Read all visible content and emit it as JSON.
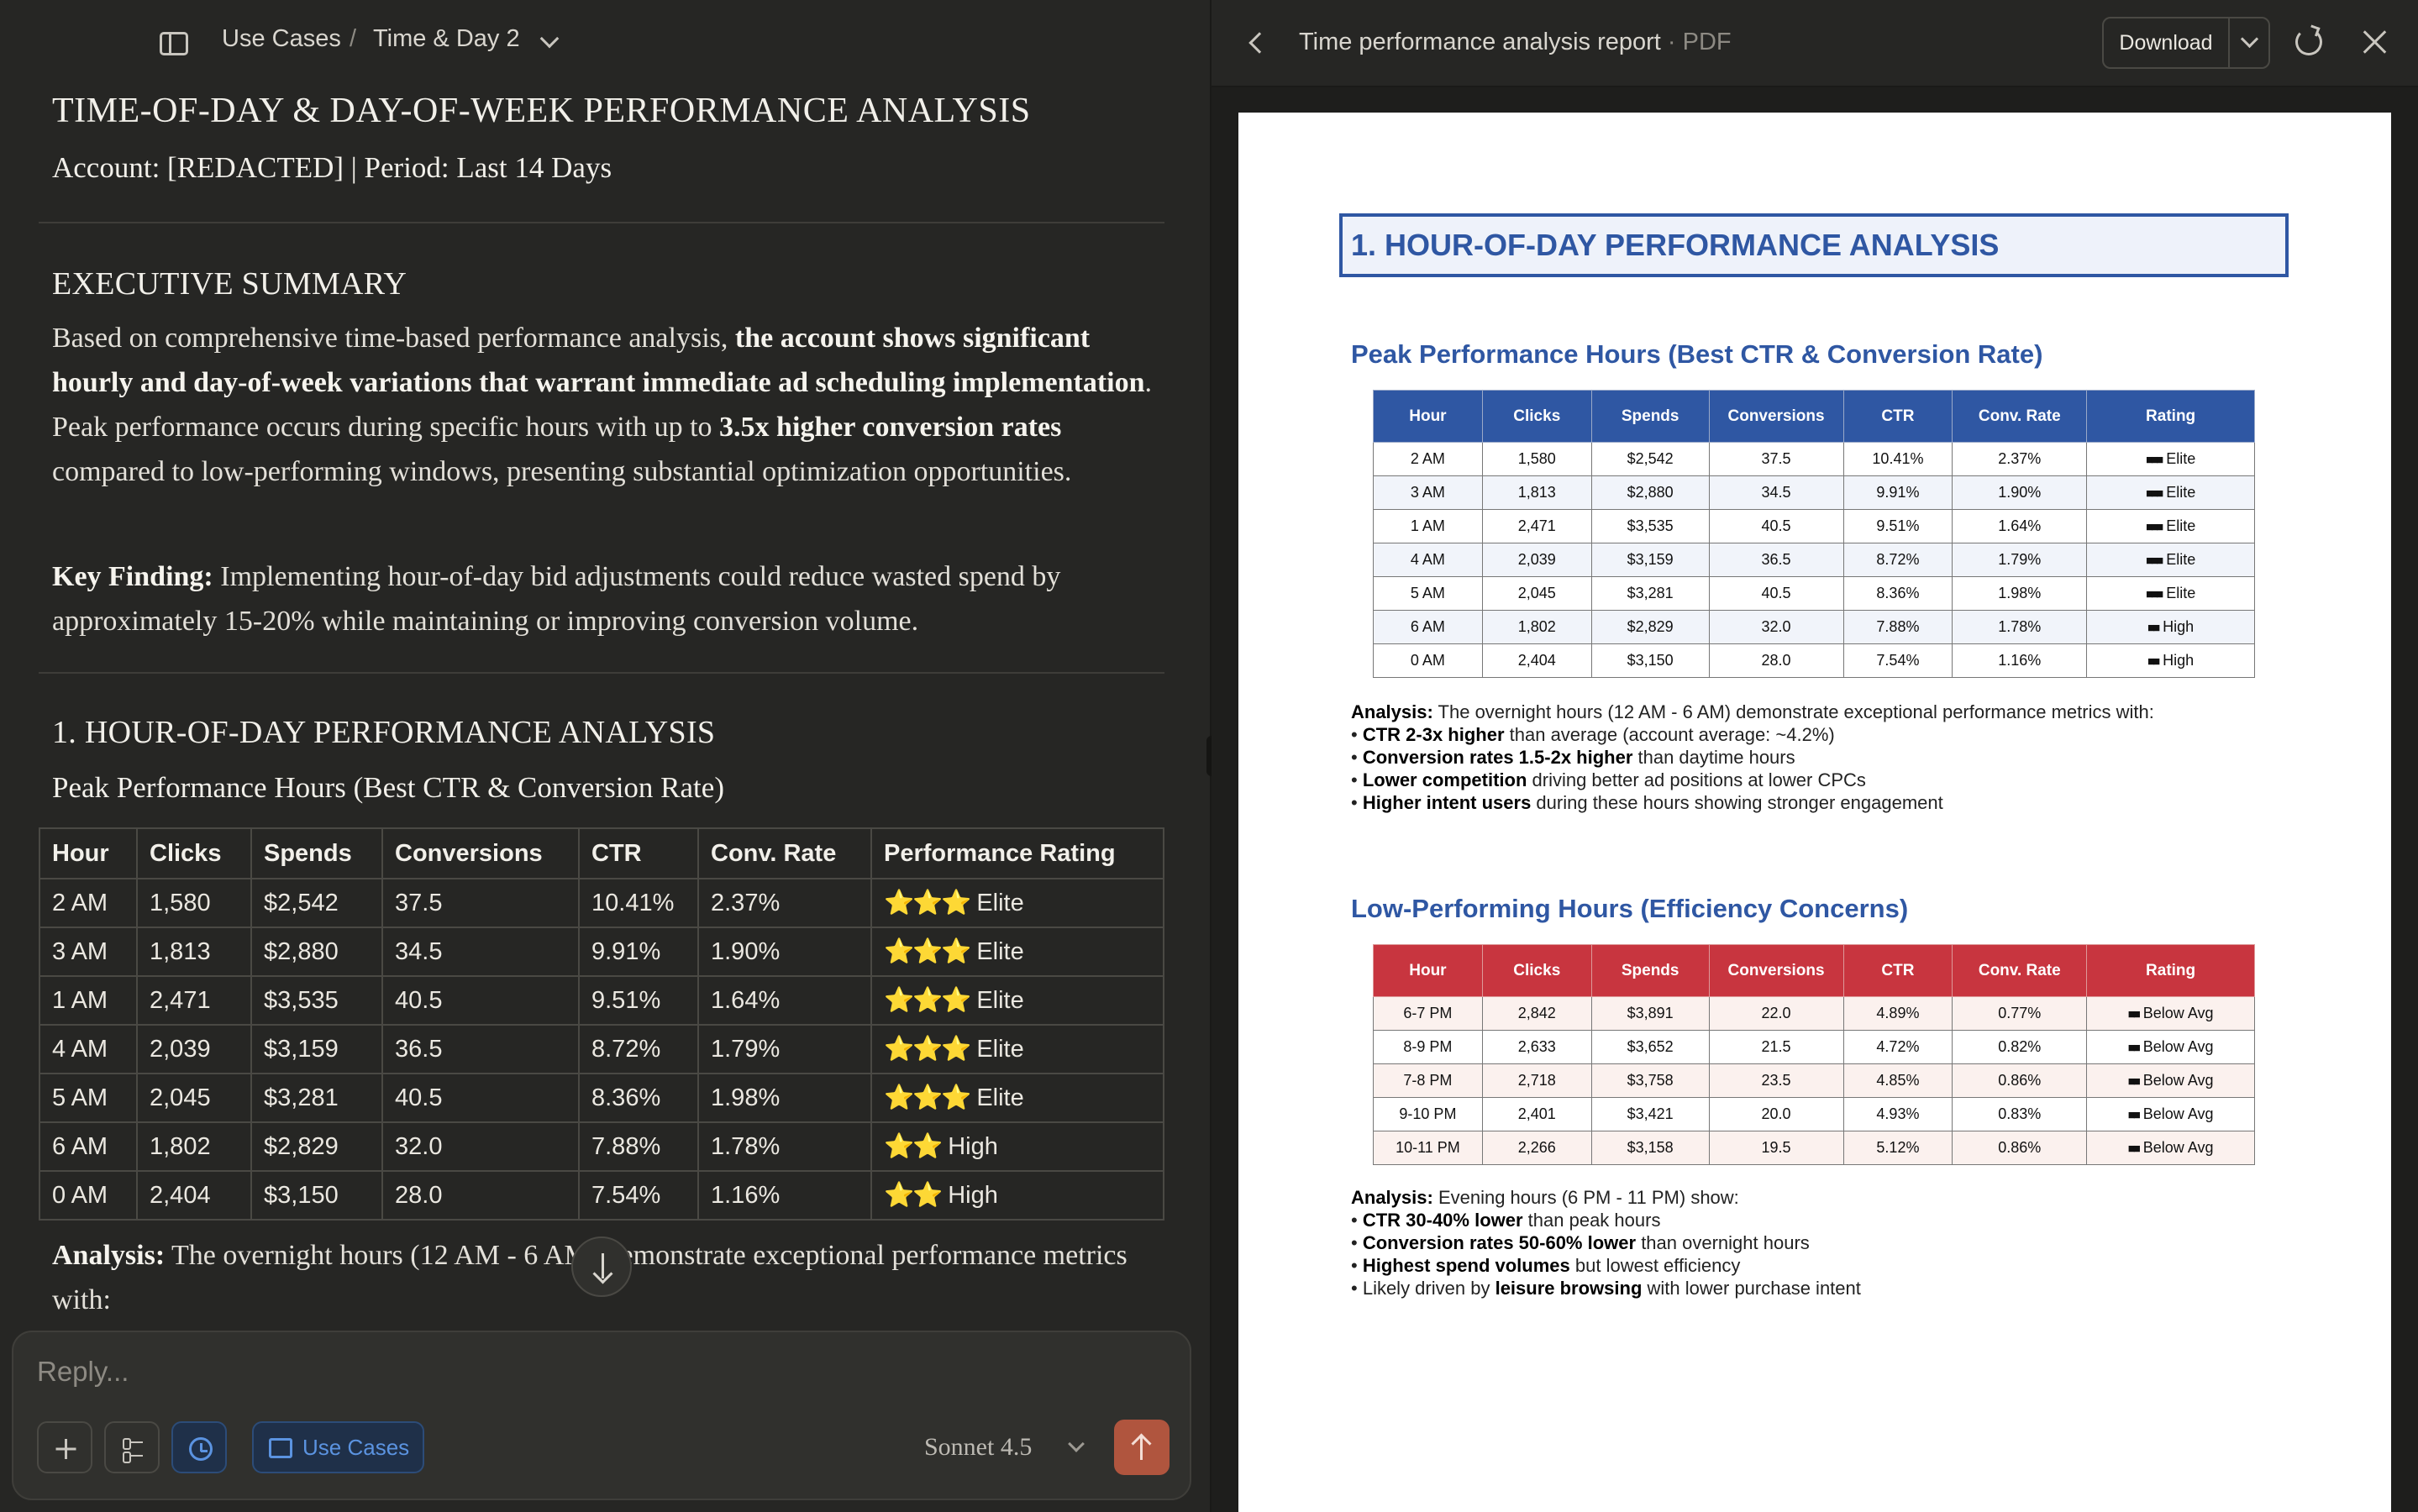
{
  "chat": {
    "breadcrumb": {
      "project": "Use Cases",
      "separator": "/",
      "chat": "Time & Day 2"
    },
    "title": "TIME-OF-DAY & DAY-OF-WEEK PERFORMANCE ANALYSIS",
    "meta": "Account: [REDACTED] | Period: Last 14 Days",
    "exec_heading": "EXECUTIVE SUMMARY",
    "exec": {
      "p1_a": "Based on comprehensive time-based performance analysis, ",
      "p1_b": "the account shows significant hourly and day-of-week variations that warrant immediate ad scheduling implementation",
      "p1_c": ". Peak performance occurs during specific hours with up to ",
      "p1_d": "3.5x higher conversion rates",
      "p1_e": " compared to low-performing windows, presenting substantial optimization opportunities.",
      "p2_label": "Key Finding:",
      "p2_text": " Implementing hour-of-day bid adjustments could reduce wasted spend by approximately 15-20% while maintaining or improving conversion volume."
    },
    "section1_heading": "1. HOUR-OF-DAY PERFORMANCE ANALYSIS",
    "peak_heading": "Peak Performance Hours (Best CTR & Conversion Rate)",
    "table_headers": [
      "Hour",
      "Clicks",
      "Spends",
      "Conversions",
      "CTR",
      "Conv. Rate",
      "Performance Rating"
    ],
    "peak_rows": [
      {
        "hour": "2 AM",
        "clicks": "1,580",
        "spend": "$2,542",
        "conv": "37.5",
        "ctr": "10.41%",
        "rate": "2.37%",
        "stars": "⭐⭐⭐",
        "rating": "Elite"
      },
      {
        "hour": "3 AM",
        "clicks": "1,813",
        "spend": "$2,880",
        "conv": "34.5",
        "ctr": "9.91%",
        "rate": "1.90%",
        "stars": "⭐⭐⭐",
        "rating": "Elite"
      },
      {
        "hour": "1 AM",
        "clicks": "2,471",
        "spend": "$3,535",
        "conv": "40.5",
        "ctr": "9.51%",
        "rate": "1.64%",
        "stars": "⭐⭐⭐",
        "rating": "Elite"
      },
      {
        "hour": "4 AM",
        "clicks": "2,039",
        "spend": "$3,159",
        "conv": "36.5",
        "ctr": "8.72%",
        "rate": "1.79%",
        "stars": "⭐⭐⭐",
        "rating": "Elite"
      },
      {
        "hour": "5 AM",
        "clicks": "2,045",
        "spend": "$3,281",
        "conv": "40.5",
        "ctr": "8.36%",
        "rate": "1.98%",
        "stars": "⭐⭐⭐",
        "rating": "Elite"
      },
      {
        "hour": "6 AM",
        "clicks": "1,802",
        "spend": "$2,829",
        "conv": "32.0",
        "ctr": "7.88%",
        "rate": "1.78%",
        "stars": "⭐⭐",
        "rating": "High"
      },
      {
        "hour": "0 AM",
        "clicks": "2,404",
        "spend": "$3,150",
        "conv": "28.0",
        "ctr": "7.54%",
        "rate": "1.16%",
        "stars": "⭐⭐",
        "rating": "High"
      }
    ],
    "analysis_label": "Analysis:",
    "analysis_text": " The overnight hours (12 AM - 6 AM) demonstrate exceptional performance metrics with:"
  },
  "composer": {
    "placeholder": "Reply...",
    "project_label": "Use Cases",
    "model": "Sonnet 4.5"
  },
  "viewer": {
    "title": "Time performance analysis report",
    "type": " · PDF",
    "download_label": "Download"
  },
  "pdf": {
    "section_heading": "1. HOUR-OF-DAY PERFORMANCE ANALYSIS",
    "peak_heading": "Peak Performance Hours (Best CTR & Conversion Rate)",
    "headers": [
      "Hour",
      "Clicks",
      "Spends",
      "Conversions",
      "CTR",
      "Conv. Rate",
      "Rating"
    ],
    "peak_rows": [
      {
        "hour": "2 AM",
        "clicks": "1,580",
        "spend": "$2,542",
        "conv": "37.5",
        "ctr": "10.41%",
        "rate": "2.37%",
        "blocks": "■■■",
        "rating": "Elite"
      },
      {
        "hour": "3 AM",
        "clicks": "1,813",
        "spend": "$2,880",
        "conv": "34.5",
        "ctr": "9.91%",
        "rate": "1.90%",
        "blocks": "■■■",
        "rating": "Elite"
      },
      {
        "hour": "1 AM",
        "clicks": "2,471",
        "spend": "$3,535",
        "conv": "40.5",
        "ctr": "9.51%",
        "rate": "1.64%",
        "blocks": "■■■",
        "rating": "Elite"
      },
      {
        "hour": "4 AM",
        "clicks": "2,039",
        "spend": "$3,159",
        "conv": "36.5",
        "ctr": "8.72%",
        "rate": "1.79%",
        "blocks": "■■■",
        "rating": "Elite"
      },
      {
        "hour": "5 AM",
        "clicks": "2,045",
        "spend": "$3,281",
        "conv": "40.5",
        "ctr": "8.36%",
        "rate": "1.98%",
        "blocks": "■■■",
        "rating": "Elite"
      },
      {
        "hour": "6 AM",
        "clicks": "1,802",
        "spend": "$2,829",
        "conv": "32.0",
        "ctr": "7.88%",
        "rate": "1.78%",
        "blocks": "■■",
        "rating": "High"
      },
      {
        "hour": "0 AM",
        "clicks": "2,404",
        "spend": "$3,150",
        "conv": "28.0",
        "ctr": "7.54%",
        "rate": "1.16%",
        "blocks": "■■",
        "rating": "High"
      }
    ],
    "peak_analysis": {
      "label": "Analysis:",
      "intro": " The overnight hours (12 AM - 6 AM) demonstrate exceptional performance metrics with:",
      "bullets": [
        {
          "bold": "CTR 2-3x higher",
          "text": " than average (account average: ~4.2%)"
        },
        {
          "bold": "Conversion rates 1.5-2x higher",
          "text": " than daytime hours"
        },
        {
          "bold": "Lower competition",
          "text": " driving better ad positions at lower CPCs"
        },
        {
          "bold": "Higher intent users",
          "text": " during these hours showing stronger engagement"
        }
      ]
    },
    "low_heading": "Low-Performing Hours (Efficiency Concerns)",
    "low_rows": [
      {
        "hour": "6-7 PM",
        "clicks": "2,842",
        "spend": "$3,891",
        "conv": "22.0",
        "ctr": "4.89%",
        "rate": "0.77%",
        "blocks": "■■",
        "rating": "Below Avg"
      },
      {
        "hour": "8-9 PM",
        "clicks": "2,633",
        "spend": "$3,652",
        "conv": "21.5",
        "ctr": "4.72%",
        "rate": "0.82%",
        "blocks": "■■",
        "rating": "Below Avg"
      },
      {
        "hour": "7-8 PM",
        "clicks": "2,718",
        "spend": "$3,758",
        "conv": "23.5",
        "ctr": "4.85%",
        "rate": "0.86%",
        "blocks": "■■",
        "rating": "Below Avg"
      },
      {
        "hour": "9-10 PM",
        "clicks": "2,401",
        "spend": "$3,421",
        "conv": "20.0",
        "ctr": "4.93%",
        "rate": "0.83%",
        "blocks": "■■",
        "rating": "Below Avg"
      },
      {
        "hour": "10-11 PM",
        "clicks": "2,266",
        "spend": "$3,158",
        "conv": "19.5",
        "ctr": "5.12%",
        "rate": "0.86%",
        "blocks": "■■",
        "rating": "Below Avg"
      }
    ],
    "low_analysis": {
      "label": "Analysis:",
      "intro": " Evening hours (6 PM - 11 PM) show:",
      "bullets": [
        {
          "pre": "",
          "bold": "CTR 30-40% lower",
          "text": " than peak hours"
        },
        {
          "pre": "",
          "bold": "Conversion rates 50-60% lower",
          "text": " than overnight hours"
        },
        {
          "pre": "",
          "bold": "Highest spend volumes",
          "text": " but lowest efficiency"
        },
        {
          "pre": "Likely driven by ",
          "bold": "leisure browsing",
          "text": " with lower purchase intent"
        }
      ]
    }
  },
  "colors": {
    "accent_blue": "#2f57a3",
    "accent_red": "#c8353f",
    "send_button": "#b0553e",
    "link_blue": "#5b93e0"
  },
  "icons": [
    "sidebar-toggle-icon",
    "chevron-down-icon",
    "arrow-down-icon",
    "plus-icon",
    "sliders-icon",
    "clock-icon",
    "folder-icon",
    "arrow-up-icon",
    "chevron-left-icon",
    "refresh-icon",
    "close-icon"
  ]
}
